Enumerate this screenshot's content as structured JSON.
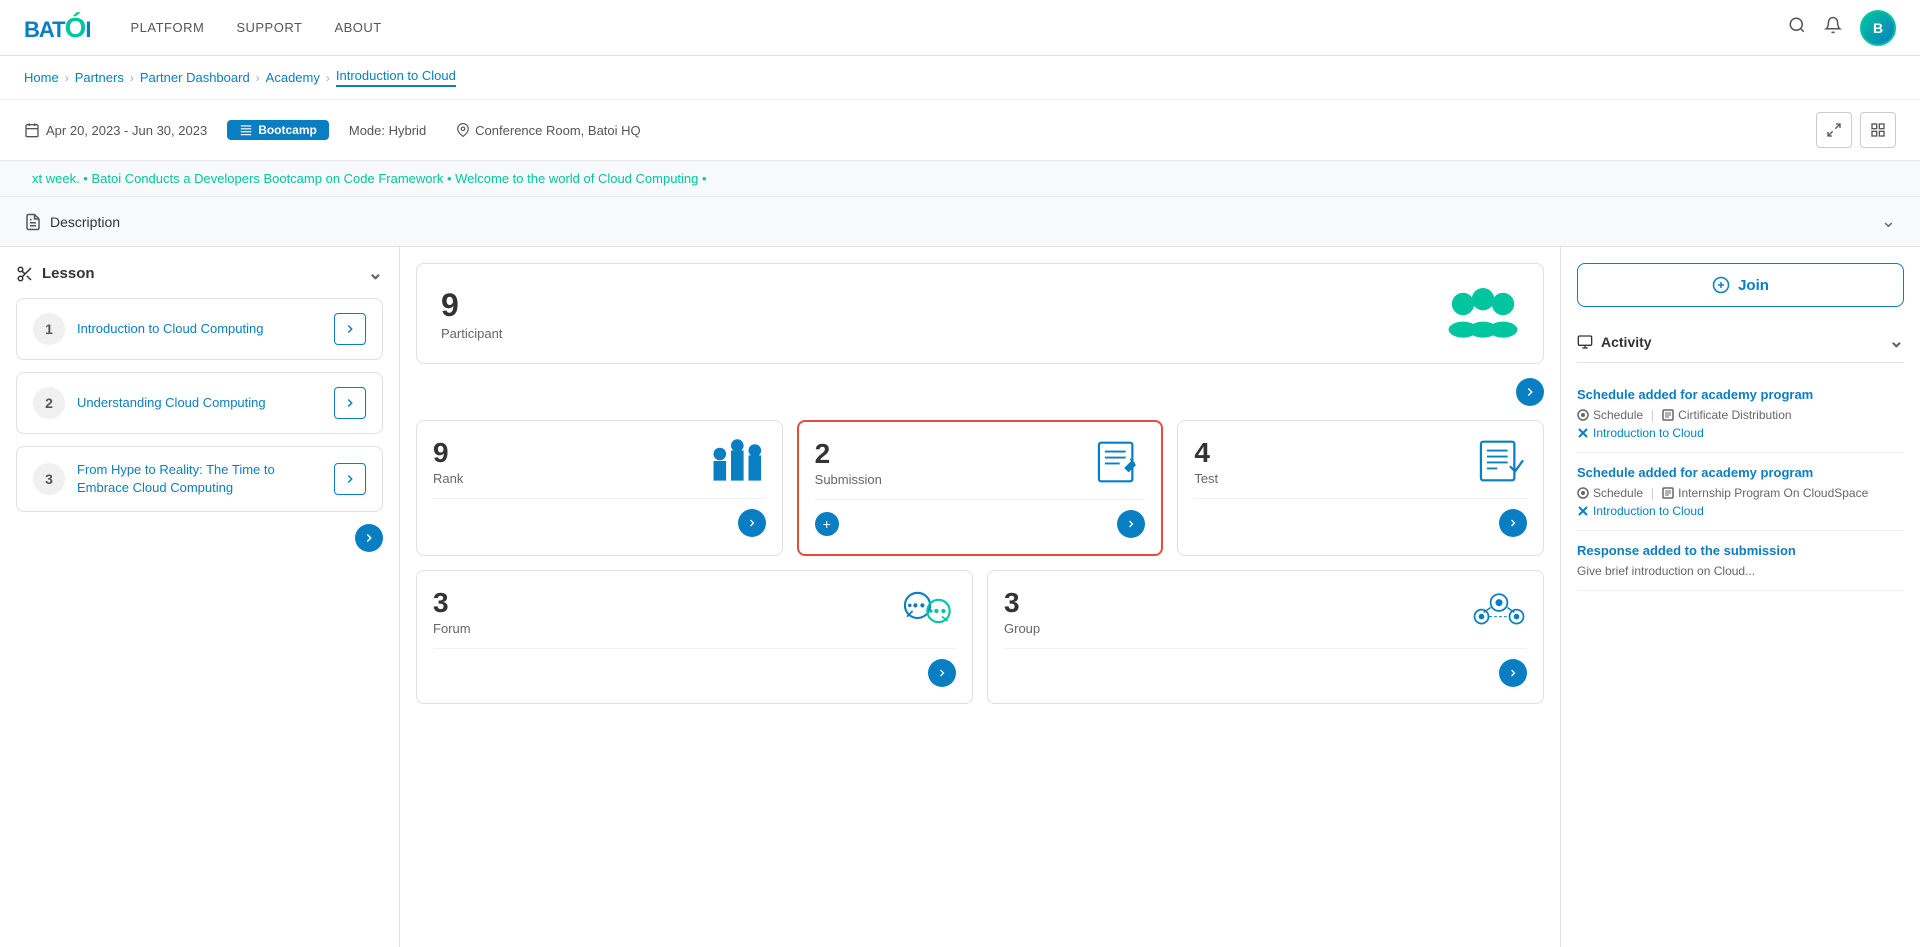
{
  "brand": {
    "name": "BATOI",
    "logo_symbol": "Ó"
  },
  "nav": {
    "links": [
      "PLATFORM",
      "SUPPORT",
      "ABOUT"
    ]
  },
  "breadcrumb": {
    "items": [
      "Home",
      "Partners",
      "Partner Dashboard",
      "Academy",
      "Introduction to Cloud"
    ]
  },
  "meta": {
    "date_range": "Apr 20, 2023  -  Jun 30, 2023",
    "badge": "Bootcamp",
    "mode": "Mode: Hybrid",
    "location": "Conference Room, Batoi HQ"
  },
  "ticker": {
    "text": "xt week.  •  Batoi Conducts a Developers Bootcamp on Code Framework  •  Welcome to the world of Cloud Computing  •"
  },
  "description_bar": {
    "label": "Description"
  },
  "sidebar": {
    "header": "Lesson",
    "lessons": [
      {
        "num": "1",
        "title": "Introduction to Cloud Computing"
      },
      {
        "num": "2",
        "title": "Understanding Cloud Computing"
      },
      {
        "num": "3",
        "title": "From Hype to Reality: The Time to Embrace Cloud Computing"
      }
    ]
  },
  "stats": {
    "participants": {
      "count": "9",
      "label": "Participant"
    },
    "rank": {
      "count": "9",
      "label": "Rank"
    },
    "submission": {
      "count": "2",
      "label": "Submission"
    },
    "test": {
      "count": "4",
      "label": "Test"
    },
    "forum": {
      "count": "3",
      "label": "Forum"
    },
    "group": {
      "count": "3",
      "label": "Group"
    }
  },
  "right_sidebar": {
    "join_label": "Join",
    "activity_header": "Activity",
    "activities": [
      {
        "title": "Schedule added for academy program",
        "meta_schedule": "Schedule",
        "meta_sep": "|",
        "meta_cert": "Cirtificate Distribution",
        "course": "Introduction to Cloud"
      },
      {
        "title": "Schedule added for academy program",
        "meta_schedule": "Schedule",
        "meta_sep": "|",
        "meta_cert": "Internship Program On CloudSpace",
        "course": "Introduction to Cloud"
      },
      {
        "title": "Response added to the submission",
        "meta_schedule": "",
        "meta_sep": "",
        "meta_cert": "Give brief introduction on Cloud...",
        "course": ""
      }
    ]
  }
}
